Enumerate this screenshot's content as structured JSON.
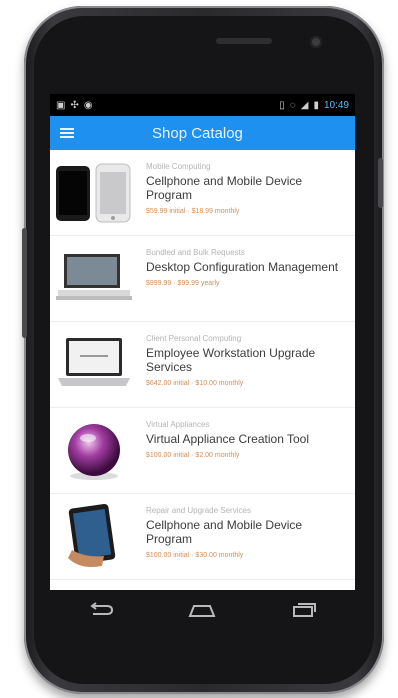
{
  "statusbar": {
    "left_icons": [
      "image-icon",
      "usb-icon",
      "android-icon"
    ],
    "right_icons": [
      "vibrate-icon",
      "alarm-icon",
      "signal-icon",
      "battery-icon"
    ],
    "time": "10:49"
  },
  "appbar": {
    "title": "Shop Catalog"
  },
  "catalog": {
    "items": [
      {
        "category": "Mobile Computing",
        "title": "Cellphone and Mobile Device Program",
        "price": "$59.99 initial · $18.99 monthly"
      },
      {
        "category": "Bundled and Bulk Requests",
        "title": "Desktop Configuration Management",
        "price": "$999.99 · $99.99 yearly"
      },
      {
        "category": "Client Personal Computing",
        "title": "Employee Workstation Upgrade Services",
        "price": "$642.00 initial · $10.00 monthly"
      },
      {
        "category": "Virtual Appliances",
        "title": "Virtual Appliance Creation Tool",
        "price": "$100.00 initial · $2.00 monthly"
      },
      {
        "category": "Repair and Upgrade Services",
        "title": "Cellphone and Mobile Device Program",
        "price": "$100.00 initial · $30.00 monthly"
      }
    ]
  },
  "navbar": {
    "icons": [
      "back-icon",
      "home-icon",
      "recent-apps-icon"
    ]
  }
}
